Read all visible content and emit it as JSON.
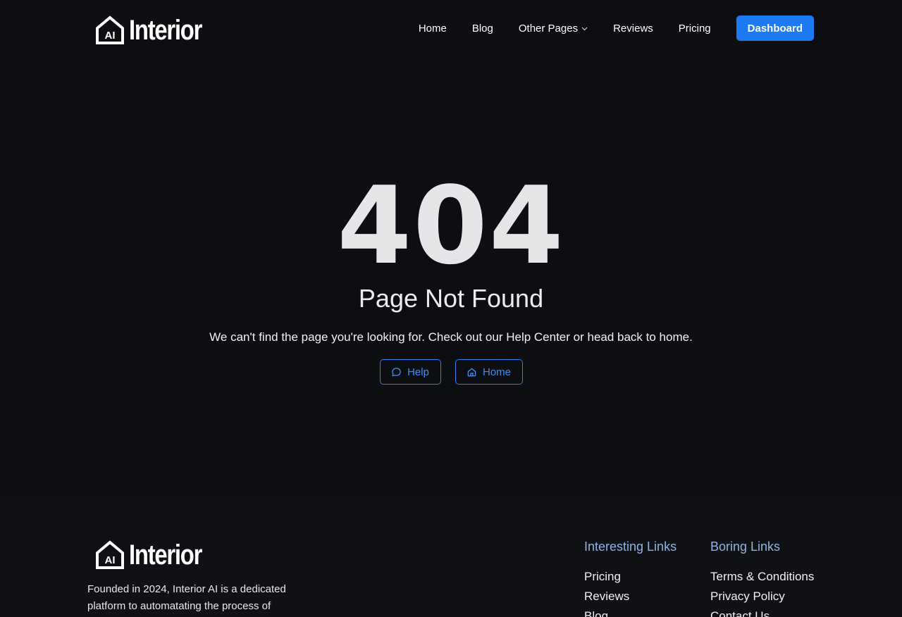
{
  "brand": {
    "logo_badge": "AI",
    "logo_text": "Interior"
  },
  "nav": {
    "items": [
      {
        "label": "Home"
      },
      {
        "label": "Blog"
      },
      {
        "label": "Other Pages"
      },
      {
        "label": "Reviews"
      },
      {
        "label": "Pricing"
      }
    ],
    "cta_label": "Dashboard"
  },
  "error": {
    "code": "404",
    "title": "Page Not Found",
    "description": "We can't find the page you're looking for. Check out our Help Center or head back to home.",
    "help_label": "Help",
    "home_label": "Home"
  },
  "footer": {
    "description": "Founded in 2024, Interior AI is a dedicated platform to automatating the process of",
    "columns": [
      {
        "title": "Interesting Links",
        "links": [
          "Pricing",
          "Reviews",
          "Blog"
        ]
      },
      {
        "title": "Boring Links",
        "links": [
          "Terms & Conditions",
          "Privacy Policy",
          "Contact Us"
        ]
      }
    ]
  },
  "colors": {
    "background": "#0d0e12",
    "footer_background": "#101114",
    "accent": "#1d7af2",
    "column_title": "#8fb3e6"
  },
  "icons": {
    "logo": "house-icon",
    "dropdown": "chevron-down-icon",
    "help": "chat-bubble-icon",
    "home": "home-icon"
  }
}
